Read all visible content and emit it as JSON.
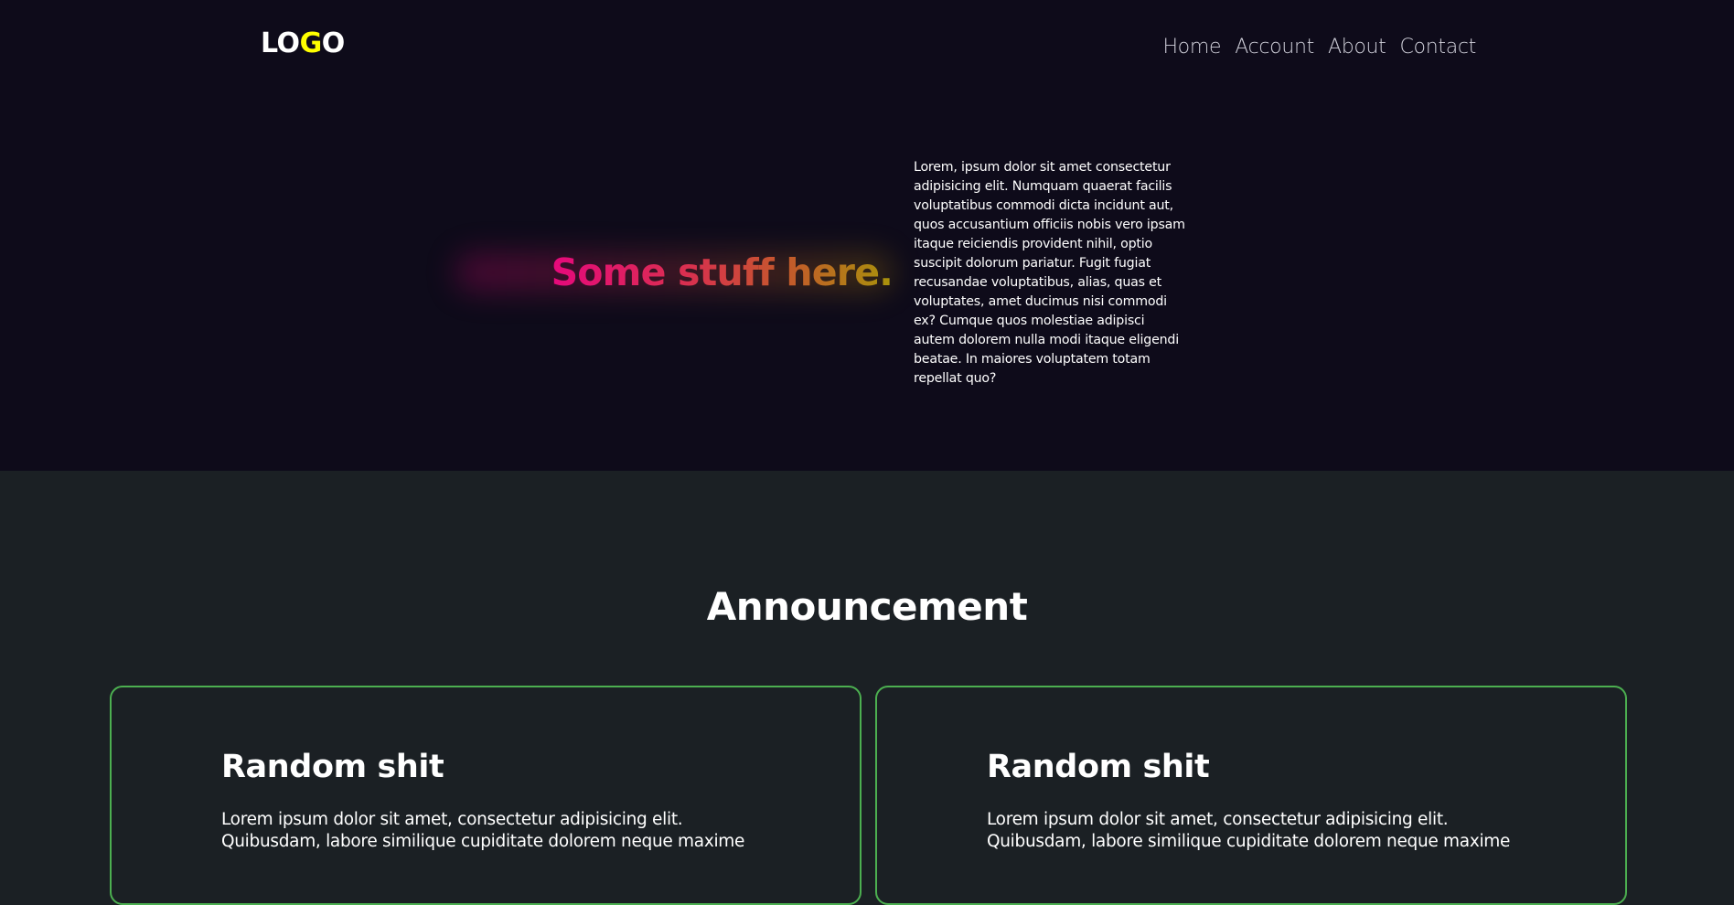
{
  "header": {
    "logo": {
      "part1": "LO",
      "part2": "G",
      "part3": "O",
      "accent_color": "#ffff00"
    },
    "nav": [
      "Home",
      "Account",
      "About",
      "Contact"
    ]
  },
  "hero": {
    "heading": "Some stuff here.",
    "text": "Lorem, ipsum dolor sit amet consectetur adipisicing elit. Numquam quaerat facilis voluptatibus commodi dicta incidunt aut, quos accusantium officiis nobis vero ipsam itaque reiciendis provident nihil, optio suscipit dolorum pariatur. Fugit fugiat recusandae voluptatibus, alias, quas et voluptates, amet ducimus nisi commodi ex? Cumque quos molestiae adipisci autem dolorem nulla modi itaque eligendi beatae. In maiores voluptatem totam repellat quo?"
  },
  "announcement": {
    "title": "Announcement",
    "cards": [
      {
        "title": "Random shit",
        "text": "Lorem ipsum dolor sit amet, consectetur adipisicing elit. Quibusdam, labore similique cupiditate dolorem neque maxime"
      },
      {
        "title": "Random shit",
        "text": "Lorem ipsum dolor sit amet, consectetur adipisicing elit. Quibusdam, labore similique cupiditate dolorem neque maxime"
      }
    ],
    "border_color": "#4caf50"
  },
  "colors": {
    "hero_bg": "#0e0b1a",
    "section_bg": "#1b2024",
    "gradient": [
      "#e6097c",
      "#d9304f",
      "#c35b2a",
      "#a8930b"
    ]
  }
}
